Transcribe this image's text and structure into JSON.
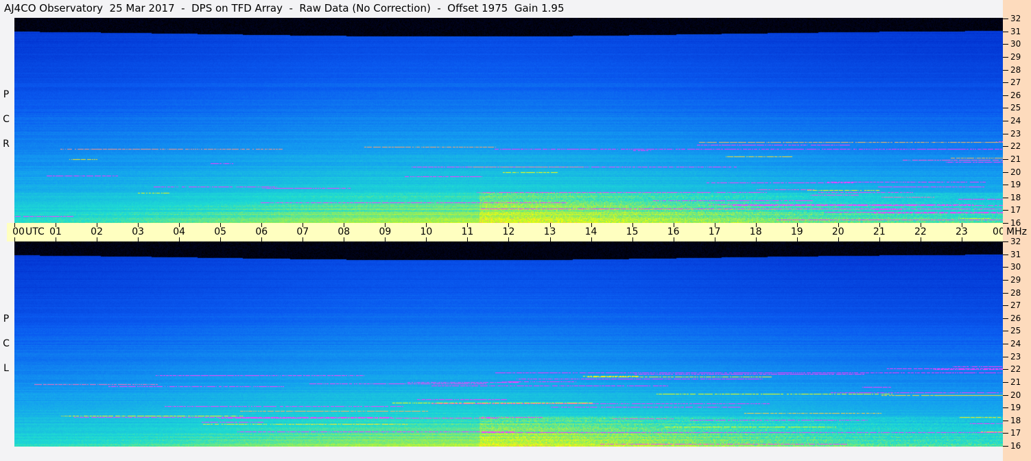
{
  "chart_data": {
    "type": "heatmap",
    "title": "AJ4CO Observatory  25 Mar 2017  -  DPS on TFD Array  -  Raw Data (No Correction)  -  Offset 1975  Gain 1.95",
    "xlabel": "UTC",
    "ylabel": "MHz",
    "x_ticks": [
      "00",
      "01",
      "02",
      "03",
      "04",
      "05",
      "06",
      "07",
      "08",
      "09",
      "10",
      "11",
      "12",
      "13",
      "14",
      "15",
      "16",
      "17",
      "18",
      "19",
      "20",
      "21",
      "22",
      "23",
      "00"
    ],
    "y_ticks": [
      "16",
      "17",
      "18",
      "19",
      "20",
      "21",
      "22",
      "23",
      "24",
      "25",
      "26",
      "27",
      "28",
      "29",
      "30",
      "31",
      "32"
    ],
    "xlim_hours": [
      0,
      24
    ],
    "ylim_mhz": [
      16,
      32
    ],
    "panels": [
      {
        "name": "RCP",
        "label_letters": [
          "R",
          "C",
          "P"
        ]
      },
      {
        "name": "LCP",
        "label_letters": [
          "L",
          "C",
          "P"
        ]
      }
    ],
    "colormap": [
      "#000000",
      "#001060",
      "#0030d0",
      "#0a5cf0",
      "#1aa0f0",
      "#20e0d0",
      "#c0f040",
      "#ffff00",
      "#ff40ff"
    ]
  }
}
